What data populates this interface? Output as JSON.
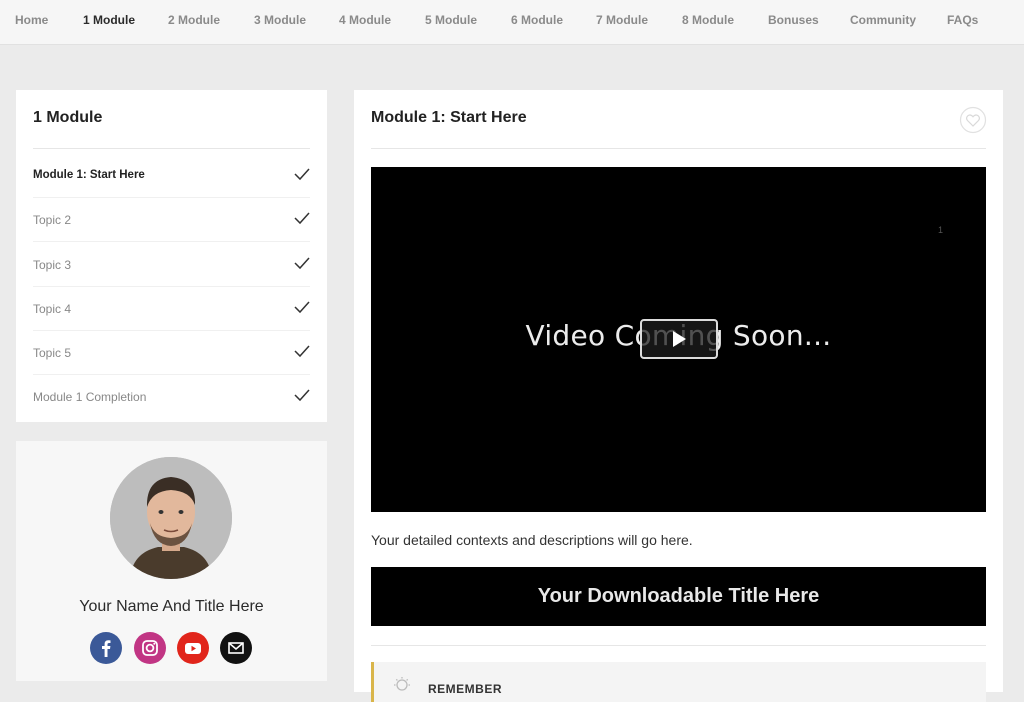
{
  "nav": {
    "items": [
      "Home",
      "1 Module",
      "2 Module",
      "3 Module",
      "4 Module",
      "5 Module",
      "6 Module",
      "7 Module",
      "8 Module",
      "Bonuses",
      "Community",
      "FAQs"
    ],
    "active": "1 Module"
  },
  "sidebar": {
    "title": "1 Module",
    "lessons": [
      {
        "label": "Module 1: Start Here",
        "completed": true,
        "current": true
      },
      {
        "label": "Topic 2",
        "completed": true
      },
      {
        "label": "Topic 3",
        "completed": true
      },
      {
        "label": "Topic 4",
        "completed": true
      },
      {
        "label": "Topic 5",
        "completed": true
      },
      {
        "label": "Module 1 Completion",
        "completed": true
      }
    ]
  },
  "profile": {
    "name": "Your Name And Title Here",
    "socials": [
      "facebook-icon",
      "instagram-icon",
      "youtube-icon",
      "email-icon"
    ]
  },
  "main": {
    "title": "Module 1: Start Here",
    "video": {
      "overlay_text": "Video Coming Soon...",
      "mark": "1"
    },
    "description": "Your detailed contexts and descriptions will go here.",
    "download_title": "Your Downloadable Title Here",
    "remember_label": "REMEMBER"
  },
  "colors": {
    "accent": "#d9b54a",
    "facebook": "#3b5998",
    "youtube": "#e1251b",
    "email": "#111111"
  }
}
